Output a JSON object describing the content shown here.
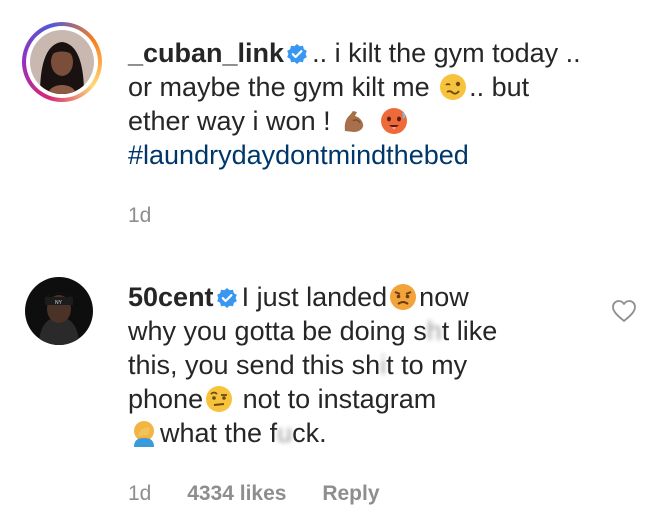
{
  "comments": [
    {
      "username": "_cuban_link",
      "line1": ".. i kilt the gym today ..",
      "line2a": "or maybe the gym kilt me",
      "line2b": ".. but",
      "line3": "ether way i won !",
      "hashtag": "#laundrydaydontmindthebed",
      "time": "1d"
    },
    {
      "username": "50cent",
      "line1a": "I just landed",
      "line1b": "now",
      "line2a": "why you gotta be doing s",
      "line2blur": "h",
      "line2b": "t like",
      "line3a": "this, you send this sh",
      "line3blur": "i",
      "line3b": "t to my",
      "line4a": "phone",
      "line4b": "not to instagram",
      "line5a": "what the f",
      "line5blur": "u",
      "line5b": "ck.",
      "time": "1d",
      "likes": "4334 likes",
      "reply_label": "Reply"
    }
  ],
  "icons": {
    "verified": "verified-badge-icon",
    "heart": "heart-outline-icon"
  },
  "colors": {
    "verified": "#3897f0",
    "hashtag": "#00376b",
    "meta": "#8e8e8e"
  }
}
